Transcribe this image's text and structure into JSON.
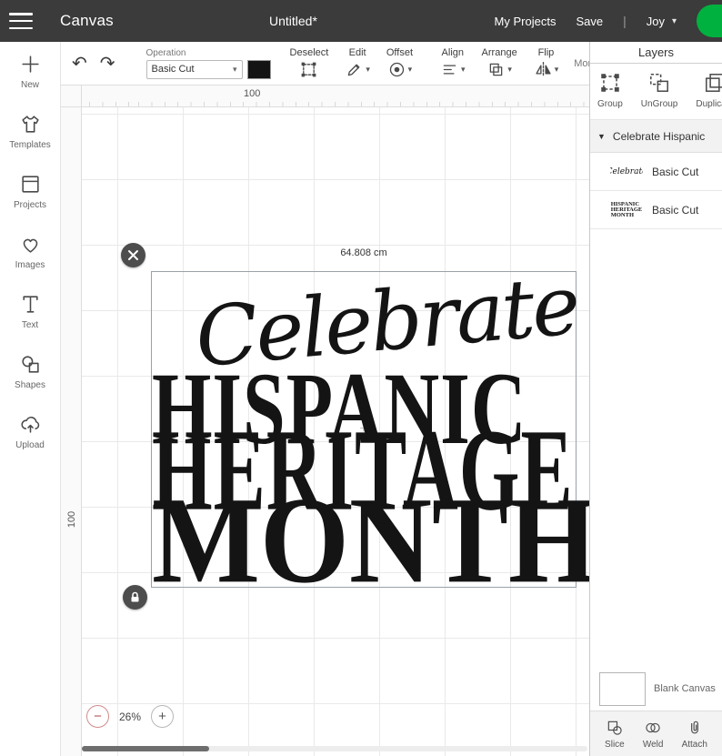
{
  "colors": {
    "accent_green": "#00b140",
    "topbar_bg": "#3b3b3b",
    "ink": "#141414"
  },
  "icons": {
    "undo": "↶",
    "redo": "↷",
    "caret_down": "▾",
    "triangle_down": "▼",
    "minus": "−",
    "plus": "+",
    "center_cross": "+",
    "divider": "|"
  },
  "topbar": {
    "app_title": "Canvas",
    "doc_title": "Untitled*",
    "my_projects": "My Projects",
    "save": "Save",
    "user": "Joy"
  },
  "sidebar": {
    "items": [
      {
        "label": "New"
      },
      {
        "label": "Templates"
      },
      {
        "label": "Projects"
      },
      {
        "label": "Images"
      },
      {
        "label": "Text"
      },
      {
        "label": "Shapes"
      },
      {
        "label": "Upload"
      }
    ]
  },
  "toolbar": {
    "operation_label": "Operation",
    "operation_value": "Basic Cut",
    "tools": {
      "deselect": "Deselect",
      "edit": "Edit",
      "offset": "Offset",
      "align": "Align",
      "arrange": "Arrange",
      "flip": "Flip",
      "more": "More"
    }
  },
  "canvas": {
    "ruler_top_label": "100",
    "ruler_left_label": "100",
    "selection_width": "64.808 cm",
    "zoom": "26%",
    "design": {
      "script_line": "Celebrate",
      "line1": "HISPANIC",
      "line2": "HERITAGE",
      "line3": "MONTH"
    }
  },
  "layers": {
    "title": "Layers",
    "actions": [
      {
        "label": "Group"
      },
      {
        "label": "UnGroup"
      },
      {
        "label": "Duplicate"
      }
    ],
    "group_name": "Celebrate Hispanic",
    "items": [
      {
        "label": "Basic Cut"
      },
      {
        "label": "Basic Cut"
      }
    ],
    "blank_canvas": "Blank Canvas",
    "bottom_actions": [
      {
        "label": "Slice"
      },
      {
        "label": "Weld"
      },
      {
        "label": "Attach"
      }
    ]
  }
}
